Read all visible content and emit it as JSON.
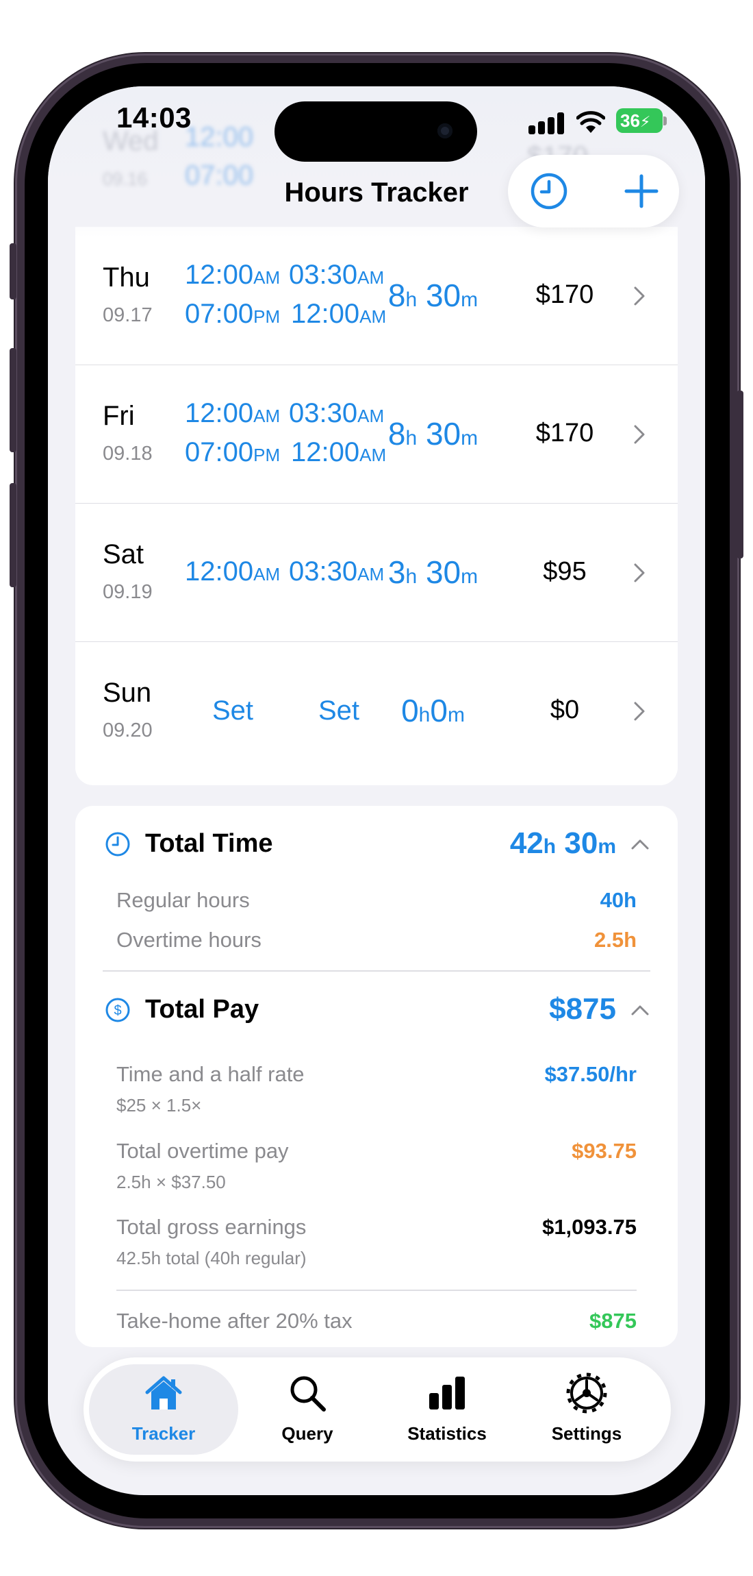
{
  "status_bar": {
    "time": "14:03",
    "battery": "36"
  },
  "header": {
    "title": "Hours Tracker",
    "ghost_day": "Wed",
    "ghost_date": "09.16",
    "ghost_t1": "12:00",
    "ghost_t2": "07:00",
    "ghost_amount": "$170"
  },
  "colors": {
    "accent": "#1e88e5",
    "overtime": "#f0923a",
    "takehome": "#34c759"
  },
  "days": [
    {
      "day": "Thu",
      "date": "09.17",
      "in1": "12:00",
      "in1_ampm": "AM",
      "out1": "03:30",
      "out1_ampm": "AM",
      "in2": "07:00",
      "in2_ampm": "PM",
      "out2": "12:00",
      "out2_ampm": "AM",
      "dur_h": "8",
      "dur_m": "30",
      "amount": "$170"
    },
    {
      "day": "Fri",
      "date": "09.18",
      "in1": "12:00",
      "in1_ampm": "AM",
      "out1": "03:30",
      "out1_ampm": "AM",
      "in2": "07:00",
      "in2_ampm": "PM",
      "out2": "12:00",
      "out2_ampm": "AM",
      "dur_h": "8",
      "dur_m": "30",
      "amount": "$170"
    },
    {
      "day": "Sat",
      "date": "09.19",
      "in1": "12:00",
      "in1_ampm": "AM",
      "out1": "03:30",
      "out1_ampm": "AM",
      "dur_h": "3",
      "dur_m": "30",
      "amount": "$95"
    },
    {
      "day": "Sun",
      "date": "09.20",
      "in1": "Set",
      "out1": "Set",
      "dur_h": "0",
      "dur_m": "0",
      "amount": "$0"
    }
  ],
  "units": {
    "h": "h",
    "m": "m"
  },
  "summary": {
    "total_time": {
      "label": "Total Time",
      "hours": "42",
      "minutes": "30"
    },
    "regular": {
      "label": "Regular hours",
      "value": "40h"
    },
    "overtime": {
      "label": "Overtime hours",
      "value": "2.5h"
    },
    "total_pay": {
      "label": "Total Pay",
      "value": "$875"
    },
    "rate": {
      "label": "Time and a half rate",
      "note": "$25 × 1.5×",
      "value": "$37.50/hr"
    },
    "ot_pay": {
      "label": "Total overtime pay",
      "note": "2.5h × $37.50",
      "value": "$93.75"
    },
    "gross": {
      "label": "Total gross earnings",
      "note": "42.5h total (40h regular)",
      "value": "$1,093.75"
    },
    "takehome": {
      "label": "Take-home after 20% tax",
      "value": "$875"
    }
  },
  "tabs": [
    {
      "label": "Tracker",
      "icon": "house-icon",
      "active": true
    },
    {
      "label": "Query",
      "icon": "search-icon"
    },
    {
      "label": "Statistics",
      "icon": "bar-chart-icon"
    },
    {
      "label": "Settings",
      "icon": "gear-icon"
    }
  ]
}
